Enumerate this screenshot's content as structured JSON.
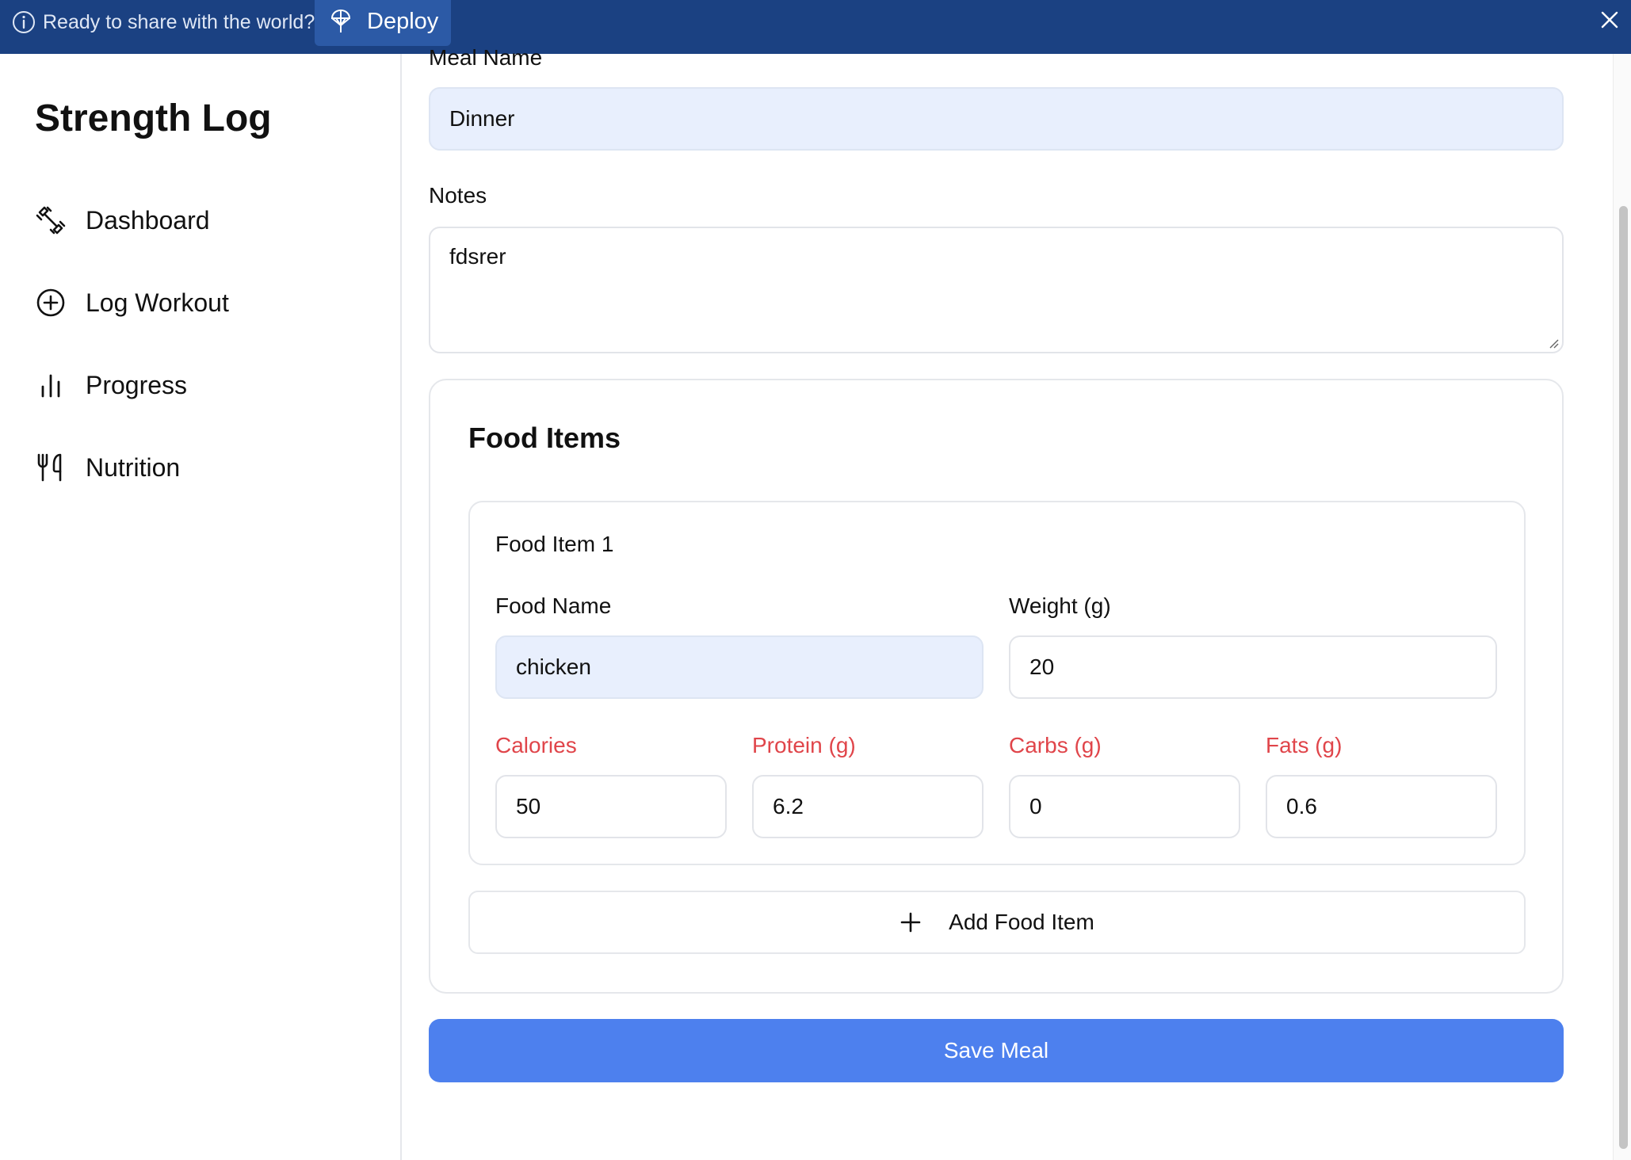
{
  "banner": {
    "share_text": "Ready to share with the world?",
    "deploy_label": "Deploy",
    "bg_color": "#1b4182"
  },
  "sidebar": {
    "title": "Strength Log",
    "items": [
      {
        "label": "Dashboard",
        "icon": "dumbbell-icon"
      },
      {
        "label": "Log Workout",
        "icon": "plus-circle-icon"
      },
      {
        "label": "Progress",
        "icon": "bar-chart-icon"
      },
      {
        "label": "Nutrition",
        "icon": "utensils-icon"
      }
    ]
  },
  "form": {
    "meal_name_label": "Meal Name",
    "meal_name_value": "Dinner",
    "notes_label": "Notes",
    "notes_value": "fdsrer",
    "food_items_title": "Food Items",
    "food_item": {
      "heading": "Food Item 1",
      "food_name_label": "Food Name",
      "food_name_value": "chicken",
      "weight_label": "Weight (g)",
      "weight_value": "20",
      "calories_label": "Calories",
      "calories_value": "50",
      "protein_label": "Protein (g)",
      "protein_value": "6.2",
      "carbs_label": "Carbs (g)",
      "carbs_value": "0",
      "fats_label": "Fats (g)",
      "fats_value": "0.6"
    },
    "add_food_label": "Add Food Item",
    "save_label": "Save Meal",
    "accent_color": "#4d80ee",
    "error_label_color": "#e0454a"
  }
}
